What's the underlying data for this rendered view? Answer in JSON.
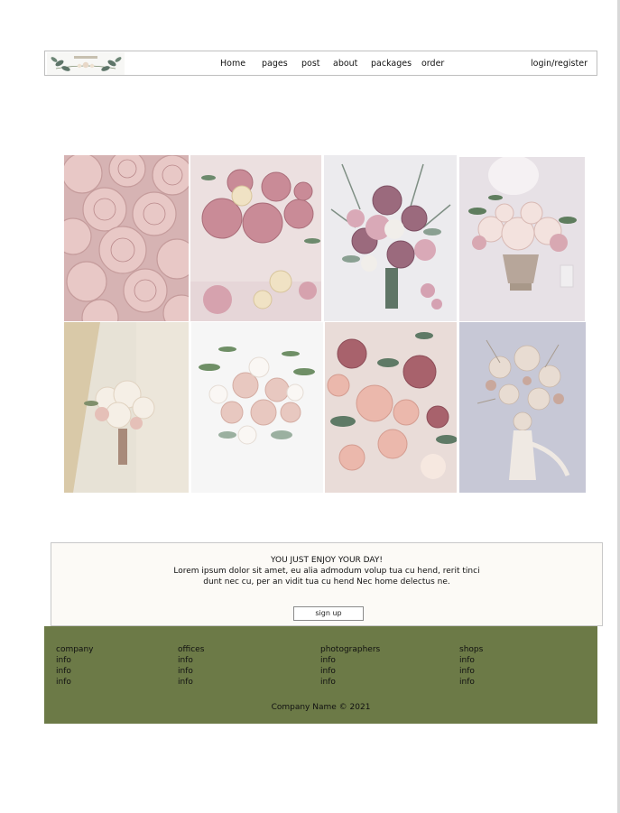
{
  "nav": {
    "items": [
      "Home",
      "pages",
      "post",
      "about",
      "packages",
      "order"
    ],
    "login": "login/register"
  },
  "cta": {
    "title": "YOU JUST ENJOY YOUR DAY!",
    "body": "Lorem ipsum dolor sit amet, eu alia admodum volup tua cu hend, rerit tinci dunt nec cu, per an vidit tua cu hend Nec home delectus ne.",
    "button": "sign up"
  },
  "footer": {
    "columns": [
      {
        "title": "company",
        "rows": [
          "info",
          "info",
          "info"
        ]
      },
      {
        "title": "offices",
        "rows": [
          "info",
          "info",
          "info"
        ]
      },
      {
        "title": "photographers",
        "rows": [
          "info",
          "info",
          "info"
        ]
      },
      {
        "title": "shops",
        "rows": [
          "info",
          "info",
          "info"
        ]
      }
    ],
    "copyright": "Company Name © 2021"
  },
  "colors": {
    "footer_bg": "#6c7a47",
    "cta_bg": "#fcfaf6"
  }
}
